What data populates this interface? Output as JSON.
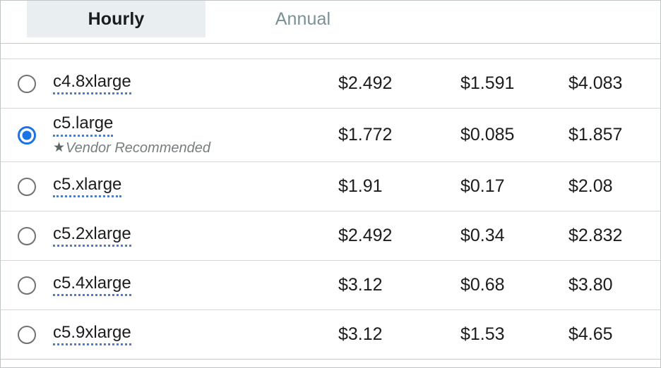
{
  "tabs": [
    {
      "id": "hourly",
      "label": "Hourly",
      "selected": true
    },
    {
      "id": "annual",
      "label": "Annual",
      "selected": false
    }
  ],
  "colors": {
    "accent_blue": "#1a73e8",
    "underline_blue": "#3b82e0",
    "tab_active_bg": "#e9eef0",
    "tab_inactive_text": "#7b9094",
    "row_border": "#d3d7d9",
    "note_text": "#767e80"
  },
  "table": {
    "clipped_row": {
      "name": "",
      "note": ""
    },
    "rows": [
      {
        "name": "c4.8xlarge",
        "selected": false,
        "note": "",
        "price1": "$2.492",
        "price2": "$1.591",
        "price3": "$4.083"
      },
      {
        "name": "c5.large",
        "selected": true,
        "note": "Vendor Recommended",
        "note_icon": "star-icon",
        "price1": "$1.772",
        "price2": "$0.085",
        "price3": "$1.857"
      },
      {
        "name": "c5.xlarge",
        "selected": false,
        "note": "",
        "price1": "$1.91",
        "price2": "$0.17",
        "price3": "$2.08"
      },
      {
        "name": "c5.2xlarge",
        "selected": false,
        "note": "",
        "price1": "$2.492",
        "price2": "$0.34",
        "price3": "$2.832"
      },
      {
        "name": "c5.4xlarge",
        "selected": false,
        "note": "",
        "price1": "$3.12",
        "price2": "$0.68",
        "price3": "$3.80"
      },
      {
        "name": "c5.9xlarge",
        "selected": false,
        "note": "",
        "price1": "$3.12",
        "price2": "$1.53",
        "price3": "$4.65"
      }
    ]
  }
}
